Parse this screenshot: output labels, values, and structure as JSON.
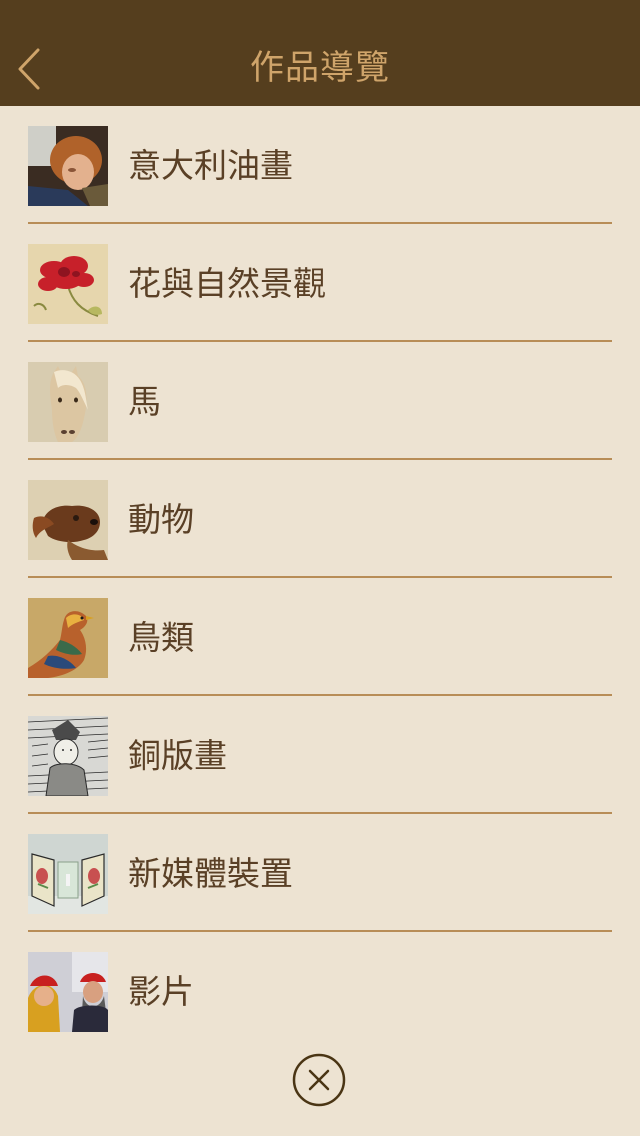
{
  "header": {
    "title": "作品導覽",
    "back_icon": "chevron-left-icon"
  },
  "menu": {
    "items": [
      {
        "label": "意大利油畫",
        "thumb": "italian-oil-painting-thumbnail"
      },
      {
        "label": "花與自然景觀",
        "thumb": "flower-thumbnail"
      },
      {
        "label": "馬",
        "thumb": "horse-thumbnail"
      },
      {
        "label": "動物",
        "thumb": "animal-thumbnail"
      },
      {
        "label": "鳥類",
        "thumb": "bird-thumbnail"
      },
      {
        "label": "銅版畫",
        "thumb": "copperplate-engraving-thumbnail"
      },
      {
        "label": "新媒體裝置",
        "thumb": "new-media-installation-thumbnail"
      },
      {
        "label": "影片",
        "thumb": "video-thumbnail"
      }
    ]
  },
  "close_icon": "close-circle-icon",
  "colors": {
    "header_bg": "#553e1e",
    "title": "#cfa46a",
    "page_bg": "#ede3d2",
    "divider": "#b88d57",
    "label": "#5a4026",
    "close": "#4a3514"
  }
}
